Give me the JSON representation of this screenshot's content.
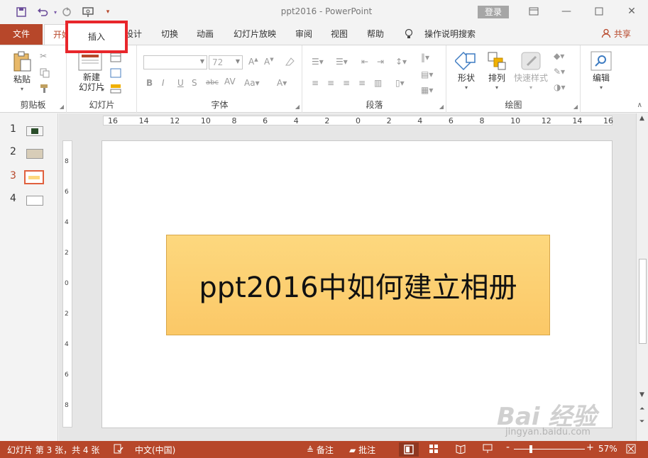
{
  "window": {
    "title": "ppt2016 - PowerPoint",
    "login_label": "登录"
  },
  "tabs": {
    "file": "文件",
    "home": "开始",
    "insert": "插入",
    "design_partial": "设计",
    "items": [
      "切换",
      "动画",
      "幻灯片放映",
      "审阅",
      "视图",
      "帮助"
    ],
    "search": "操作说明搜索",
    "share": "共享"
  },
  "ribbon": {
    "clipboard": {
      "paste": "粘贴",
      "label": "剪贴板"
    },
    "slides": {
      "new_slide_1": "新建",
      "new_slide_2": "幻灯片",
      "label": "幻灯片"
    },
    "font": {
      "font_name": "",
      "font_size": "72",
      "label": "字体"
    },
    "paragraph": {
      "label": "段落"
    },
    "drawing": {
      "shape": "形状",
      "arrange": "排列",
      "quick_styles": "快速样式",
      "label": "绘图"
    },
    "editing": {
      "label": "编辑"
    }
  },
  "thumbnails": [
    {
      "num": "1"
    },
    {
      "num": "2"
    },
    {
      "num": "3",
      "active": true
    },
    {
      "num": "4"
    }
  ],
  "ruler": {
    "h_labels": [
      "16",
      "14",
      "12",
      "10",
      "8",
      "6",
      "4",
      "2",
      "0",
      "2",
      "4",
      "6",
      "8",
      "10",
      "12",
      "14",
      "16"
    ],
    "v_labels": [
      "8",
      "6",
      "4",
      "2",
      "0",
      "2",
      "4",
      "6",
      "8"
    ]
  },
  "slide": {
    "title_text": "ppt2016中如何建立相册"
  },
  "status": {
    "slide_info": "幻灯片 第 3 张，共 4 张",
    "language": "中文(中国)",
    "notes": "备注",
    "comments": "批注",
    "zoom": "57%"
  },
  "watermark": {
    "main": "Bai 经验",
    "sub": "jingyan.baidu.com"
  },
  "colors": {
    "accent": "#b7472a",
    "highlight": "#e8262b",
    "title_fill": "#fdd87e"
  }
}
